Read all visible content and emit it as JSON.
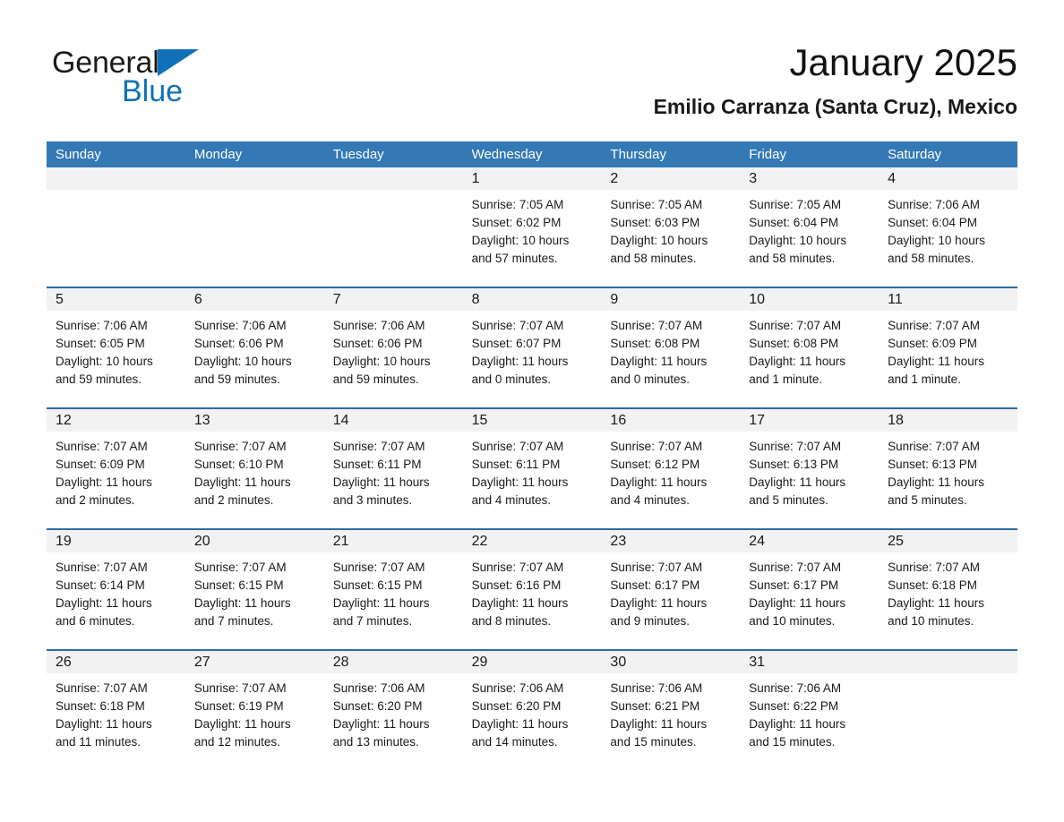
{
  "brand": {
    "name_part1": "General",
    "name_part2": "Blue",
    "triangle_color": "#1071B8"
  },
  "header": {
    "month_title": "January 2025",
    "location": "Emilio Carranza (Santa Cruz), Mexico"
  },
  "theme": {
    "header_blue": "#3479B5",
    "rule_blue": "#2B6CA8",
    "daynum_band": "#F2F2F2",
    "text": "#1a1a1a"
  },
  "calendar": {
    "weekdays": [
      "Sunday",
      "Monday",
      "Tuesday",
      "Wednesday",
      "Thursday",
      "Friday",
      "Saturday"
    ],
    "weeks": [
      [
        {
          "day": "",
          "lines": [
            "",
            "",
            "",
            ""
          ]
        },
        {
          "day": "",
          "lines": [
            "",
            "",
            "",
            ""
          ]
        },
        {
          "day": "",
          "lines": [
            "",
            "",
            "",
            ""
          ]
        },
        {
          "day": "1",
          "lines": [
            "Sunrise: 7:05 AM",
            "Sunset: 6:02 PM",
            "Daylight: 10 hours",
            "and 57 minutes."
          ]
        },
        {
          "day": "2",
          "lines": [
            "Sunrise: 7:05 AM",
            "Sunset: 6:03 PM",
            "Daylight: 10 hours",
            "and 58 minutes."
          ]
        },
        {
          "day": "3",
          "lines": [
            "Sunrise: 7:05 AM",
            "Sunset: 6:04 PM",
            "Daylight: 10 hours",
            "and 58 minutes."
          ]
        },
        {
          "day": "4",
          "lines": [
            "Sunrise: 7:06 AM",
            "Sunset: 6:04 PM",
            "Daylight: 10 hours",
            "and 58 minutes."
          ]
        }
      ],
      [
        {
          "day": "5",
          "lines": [
            "Sunrise: 7:06 AM",
            "Sunset: 6:05 PM",
            "Daylight: 10 hours",
            "and 59 minutes."
          ]
        },
        {
          "day": "6",
          "lines": [
            "Sunrise: 7:06 AM",
            "Sunset: 6:06 PM",
            "Daylight: 10 hours",
            "and 59 minutes."
          ]
        },
        {
          "day": "7",
          "lines": [
            "Sunrise: 7:06 AM",
            "Sunset: 6:06 PM",
            "Daylight: 10 hours",
            "and 59 minutes."
          ]
        },
        {
          "day": "8",
          "lines": [
            "Sunrise: 7:07 AM",
            "Sunset: 6:07 PM",
            "Daylight: 11 hours",
            "and 0 minutes."
          ]
        },
        {
          "day": "9",
          "lines": [
            "Sunrise: 7:07 AM",
            "Sunset: 6:08 PM",
            "Daylight: 11 hours",
            "and 0 minutes."
          ]
        },
        {
          "day": "10",
          "lines": [
            "Sunrise: 7:07 AM",
            "Sunset: 6:08 PM",
            "Daylight: 11 hours",
            "and 1 minute."
          ]
        },
        {
          "day": "11",
          "lines": [
            "Sunrise: 7:07 AM",
            "Sunset: 6:09 PM",
            "Daylight: 11 hours",
            "and 1 minute."
          ]
        }
      ],
      [
        {
          "day": "12",
          "lines": [
            "Sunrise: 7:07 AM",
            "Sunset: 6:09 PM",
            "Daylight: 11 hours",
            "and 2 minutes."
          ]
        },
        {
          "day": "13",
          "lines": [
            "Sunrise: 7:07 AM",
            "Sunset: 6:10 PM",
            "Daylight: 11 hours",
            "and 2 minutes."
          ]
        },
        {
          "day": "14",
          "lines": [
            "Sunrise: 7:07 AM",
            "Sunset: 6:11 PM",
            "Daylight: 11 hours",
            "and 3 minutes."
          ]
        },
        {
          "day": "15",
          "lines": [
            "Sunrise: 7:07 AM",
            "Sunset: 6:11 PM",
            "Daylight: 11 hours",
            "and 4 minutes."
          ]
        },
        {
          "day": "16",
          "lines": [
            "Sunrise: 7:07 AM",
            "Sunset: 6:12 PM",
            "Daylight: 11 hours",
            "and 4 minutes."
          ]
        },
        {
          "day": "17",
          "lines": [
            "Sunrise: 7:07 AM",
            "Sunset: 6:13 PM",
            "Daylight: 11 hours",
            "and 5 minutes."
          ]
        },
        {
          "day": "18",
          "lines": [
            "Sunrise: 7:07 AM",
            "Sunset: 6:13 PM",
            "Daylight: 11 hours",
            "and 5 minutes."
          ]
        }
      ],
      [
        {
          "day": "19",
          "lines": [
            "Sunrise: 7:07 AM",
            "Sunset: 6:14 PM",
            "Daylight: 11 hours",
            "and 6 minutes."
          ]
        },
        {
          "day": "20",
          "lines": [
            "Sunrise: 7:07 AM",
            "Sunset: 6:15 PM",
            "Daylight: 11 hours",
            "and 7 minutes."
          ]
        },
        {
          "day": "21",
          "lines": [
            "Sunrise: 7:07 AM",
            "Sunset: 6:15 PM",
            "Daylight: 11 hours",
            "and 7 minutes."
          ]
        },
        {
          "day": "22",
          "lines": [
            "Sunrise: 7:07 AM",
            "Sunset: 6:16 PM",
            "Daylight: 11 hours",
            "and 8 minutes."
          ]
        },
        {
          "day": "23",
          "lines": [
            "Sunrise: 7:07 AM",
            "Sunset: 6:17 PM",
            "Daylight: 11 hours",
            "and 9 minutes."
          ]
        },
        {
          "day": "24",
          "lines": [
            "Sunrise: 7:07 AM",
            "Sunset: 6:17 PM",
            "Daylight: 11 hours",
            "and 10 minutes."
          ]
        },
        {
          "day": "25",
          "lines": [
            "Sunrise: 7:07 AM",
            "Sunset: 6:18 PM",
            "Daylight: 11 hours",
            "and 10 minutes."
          ]
        }
      ],
      [
        {
          "day": "26",
          "lines": [
            "Sunrise: 7:07 AM",
            "Sunset: 6:18 PM",
            "Daylight: 11 hours",
            "and 11 minutes."
          ]
        },
        {
          "day": "27",
          "lines": [
            "Sunrise: 7:07 AM",
            "Sunset: 6:19 PM",
            "Daylight: 11 hours",
            "and 12 minutes."
          ]
        },
        {
          "day": "28",
          "lines": [
            "Sunrise: 7:06 AM",
            "Sunset: 6:20 PM",
            "Daylight: 11 hours",
            "and 13 minutes."
          ]
        },
        {
          "day": "29",
          "lines": [
            "Sunrise: 7:06 AM",
            "Sunset: 6:20 PM",
            "Daylight: 11 hours",
            "and 14 minutes."
          ]
        },
        {
          "day": "30",
          "lines": [
            "Sunrise: 7:06 AM",
            "Sunset: 6:21 PM",
            "Daylight: 11 hours",
            "and 15 minutes."
          ]
        },
        {
          "day": "31",
          "lines": [
            "Sunrise: 7:06 AM",
            "Sunset: 6:22 PM",
            "Daylight: 11 hours",
            "and 15 minutes."
          ]
        },
        {
          "day": "",
          "lines": [
            "",
            "",
            "",
            ""
          ]
        }
      ]
    ]
  }
}
